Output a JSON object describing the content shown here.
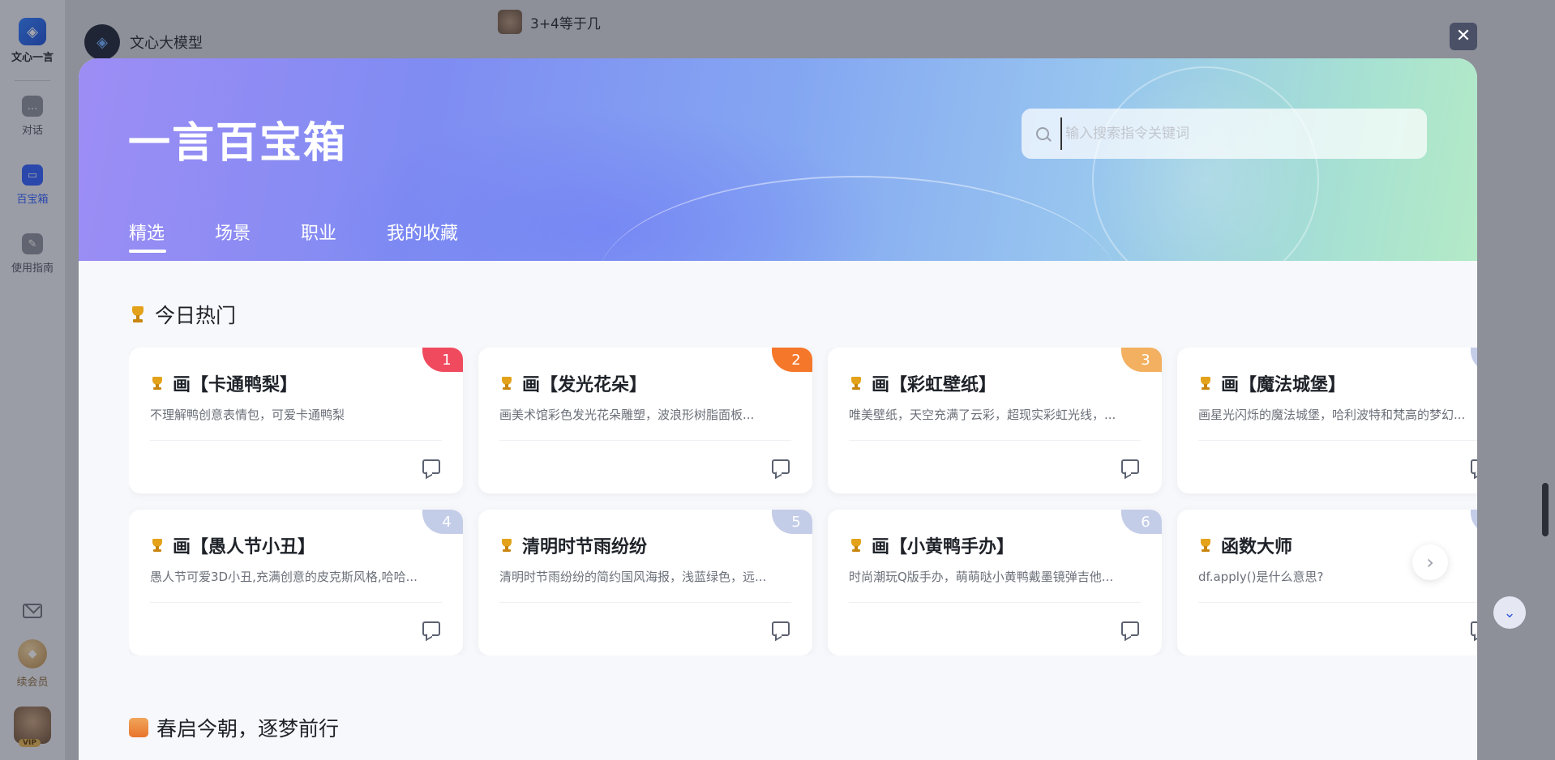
{
  "app": {
    "rail_logo_text": "文心一言",
    "rail_items": [
      {
        "label": "对话",
        "icon": "chat-bubble-icon"
      },
      {
        "label": "百宝箱",
        "icon": "toolbox-icon",
        "active": true
      },
      {
        "label": "使用指南",
        "icon": "guide-icon"
      }
    ],
    "vip_label": "续会员",
    "vip_tag": "VIP",
    "model_name": "文心大模型",
    "conversation_title": "3+4等于几",
    "close_glyph": "✕",
    "down_glyph": "⌄"
  },
  "modal": {
    "title": "一言百宝箱",
    "search_placeholder": "输入搜索指令关键词",
    "tabs": [
      "精选",
      "场景",
      "职业",
      "我的收藏"
    ],
    "active_tab": "精选",
    "section_hot": "今日热门",
    "section_spring": "春启今朝，逐梦前行",
    "next_glyph": "›"
  },
  "cards": [
    {
      "title": "画【卡通鸭梨】",
      "desc": "不理解鸭创意表情包，可爱卡通鸭梨",
      "rank": "1",
      "rank_color": "#f04a5e"
    },
    {
      "title": "画【发光花朵】",
      "desc": "画美术馆彩色发光花朵雕塑，波浪形树脂面板...",
      "rank": "2",
      "rank_color": "#f5772a"
    },
    {
      "title": "画【彩虹壁纸】",
      "desc": "唯美壁纸，天空充满了云彩，超现实彩虹光线，...",
      "rank": "3",
      "rank_color": "#f2b060"
    },
    {
      "title": "画【魔法城堡】",
      "desc": "画星光闪烁的魔法城堡，哈利波特和梵高的梦幻...",
      "rank": "",
      "rank_color": "#c4cde8"
    },
    {
      "title": "画【愚人节小丑】",
      "desc": "愚人节可爱3D小丑,充满创意的皮克斯风格,哈哈...",
      "rank": "4",
      "rank_color": "#c4cde8"
    },
    {
      "title": "清明时节雨纷纷",
      "desc": "清明时节雨纷纷的简约国风海报，浅蓝绿色，远...",
      "rank": "5",
      "rank_color": "#c4cde8"
    },
    {
      "title": "画【小黄鸭手办】",
      "desc": "时尚潮玩Q版手办，萌萌哒小黄鸭戴墨镜弹吉他...",
      "rank": "6",
      "rank_color": "#c4cde8"
    },
    {
      "title": "函数大师",
      "desc": "df.apply()是什么意思?",
      "rank": "",
      "rank_color": "#c4cde8"
    }
  ]
}
